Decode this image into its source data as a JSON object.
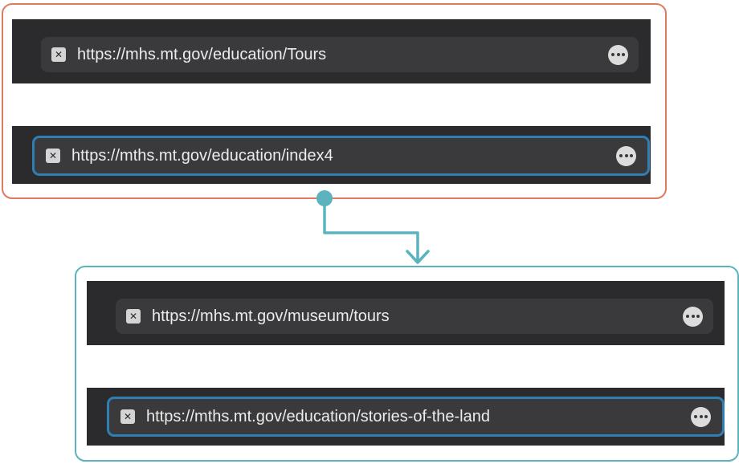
{
  "colors": {
    "original_frame": "#e07a5f",
    "rewritten_frame": "#5ab3bd",
    "highlight": "#2f7fb5",
    "toolbar": "#2b2b2d",
    "urlbar": "#3a3a3c"
  },
  "before": {
    "top_url": "https://mhs.mt.gov/education/Tours",
    "bottom_url": "https://mths.mt.gov/education/index4"
  },
  "after": {
    "top_url": "https://mhs.mt.gov/museum/tours",
    "bottom_url": "https://mths.mt.gov/education/stories-of-the-land"
  },
  "icons": {
    "close": "close-icon",
    "more": "more-options-icon",
    "close_glyph": "✕"
  }
}
